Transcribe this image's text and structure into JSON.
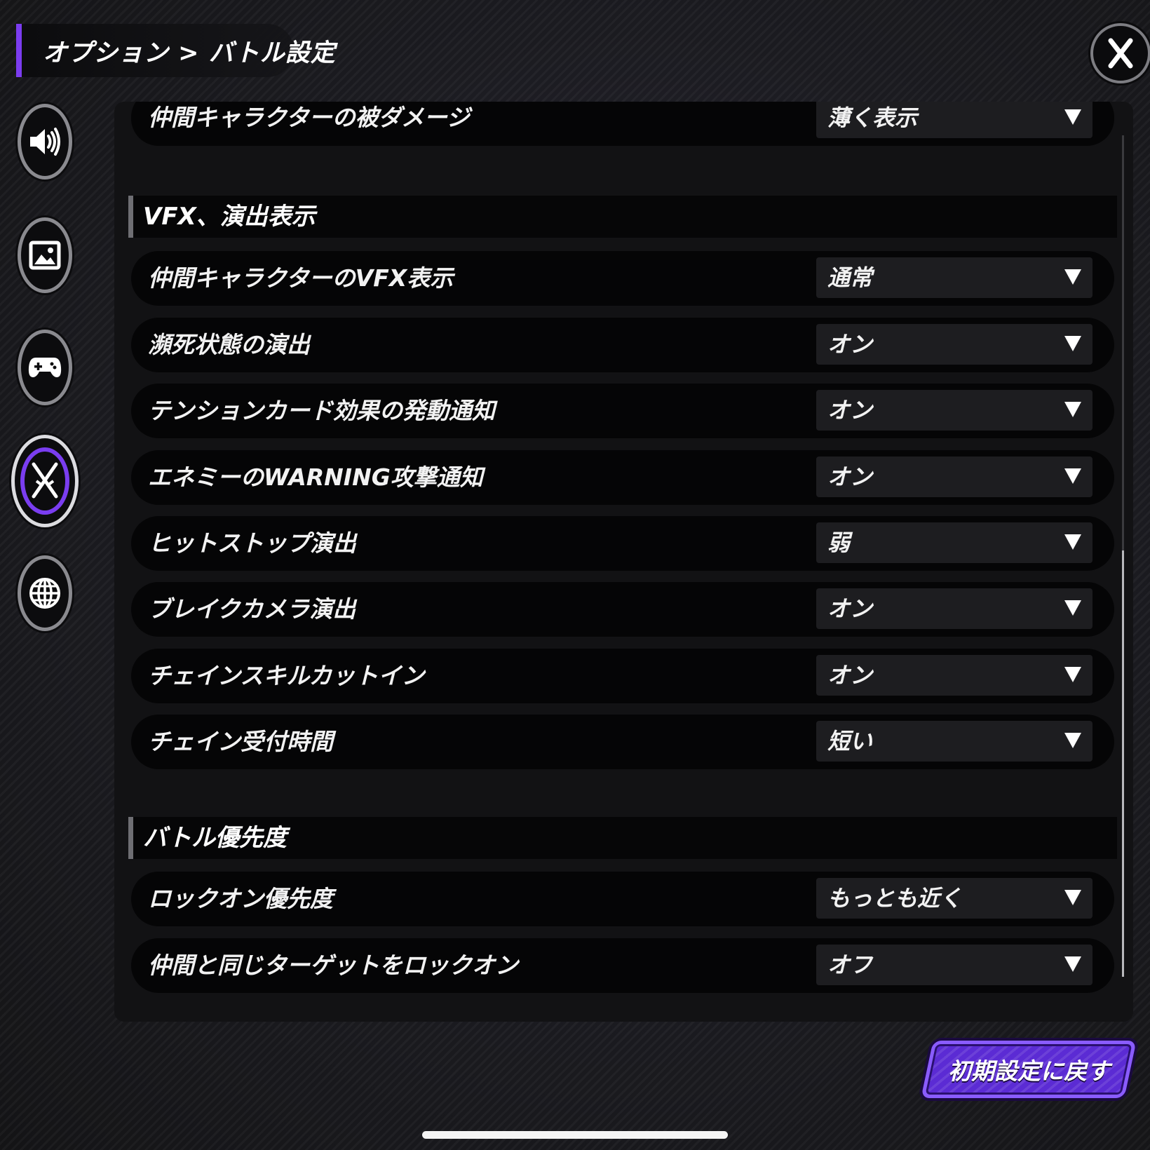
{
  "header": {
    "icon": "gears-icon",
    "title": "オプション > バトル設定"
  },
  "close": {
    "icon": "close-x-icon"
  },
  "nav": [
    {
      "icon": "speaker-icon",
      "active": false
    },
    {
      "icon": "image-icon",
      "active": false
    },
    {
      "icon": "gamepad-icon",
      "active": false
    },
    {
      "icon": "crossed-swords-icon",
      "active": true
    },
    {
      "icon": "globe-icon",
      "active": false
    }
  ],
  "partial_row": {
    "label": "仲間キャラクターの被ダメージ",
    "value": "薄く表示"
  },
  "sections": {
    "vfx": {
      "title": "VFX、演出表示",
      "rows": [
        {
          "label": "仲間キャラクターのVFX表示",
          "value": "通常"
        },
        {
          "label": "瀕死状態の演出",
          "value": "オン"
        },
        {
          "label": "テンションカード効果の発動通知",
          "value": "オン"
        },
        {
          "label": "エネミーのWARNING攻撃通知",
          "value": "オン"
        },
        {
          "label": "ヒットストップ演出",
          "value": "弱"
        },
        {
          "label": "ブレイクカメラ演出",
          "value": "オン"
        },
        {
          "label": "チェインスキルカットイン",
          "value": "オン"
        },
        {
          "label": "チェイン受付時間",
          "value": "短い"
        }
      ]
    },
    "priority": {
      "title": "バトル優先度",
      "rows": [
        {
          "label": "ロックオン優先度",
          "value": "もっとも近く"
        },
        {
          "label": "仲間と同じターゲットをロックオン",
          "value": "オフ"
        }
      ]
    }
  },
  "reset_button": {
    "label": "初期設定に戻す"
  },
  "colors": {
    "accent": "#7b3cf0",
    "button": "#5b2bd4",
    "row": "#050506",
    "select": "#1d1d20"
  }
}
